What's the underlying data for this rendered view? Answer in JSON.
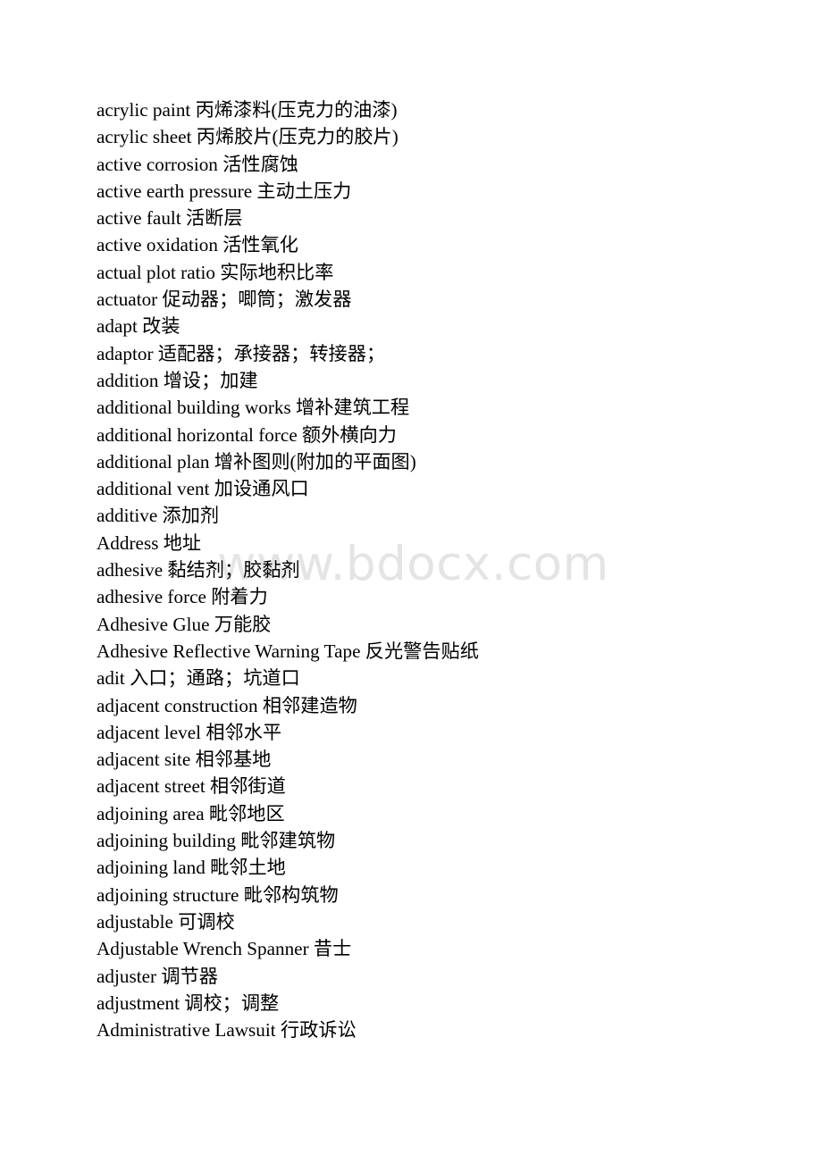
{
  "page": {
    "background_color": "#ffffff",
    "text_color": "#000000"
  },
  "watermark": {
    "text": "www.bdocx.com",
    "color": "#e4e4e4"
  },
  "glossary": {
    "entries": [
      "acrylic paint 丙烯漆料(压克力的油漆)",
      "acrylic sheet 丙烯胶片(压克力的胶片)",
      "active corrosion 活性腐蚀",
      "active earth pressure 主动土压力",
      "active fault 活断层",
      "active oxidation 活性氧化",
      "actual plot ratio 实际地积比率",
      "actuator 促动器；唧筒；激发器",
      "adapt 改装",
      "adaptor 适配器；承接器；转接器；",
      "addition 增设；加建",
      "additional building works 增补建筑工程",
      "additional horizontal force 额外横向力",
      "additional plan 增补图则(附加的平面图)",
      "additional vent 加设通风口",
      "additive 添加剂",
      "Address 地址",
      "adhesive 黏结剂；胶黏剂",
      "adhesive force 附着力",
      "Adhesive Glue 万能胶",
      "Adhesive Reflective Warning Tape 反光警告贴纸",
      "adit 入口；通路；坑道口",
      "adjacent construction 相邻建造物",
      "adjacent level 相邻水平",
      "adjacent site 相邻基地",
      "adjacent street 相邻街道",
      "adjoining area 毗邻地区",
      "adjoining building 毗邻建筑物",
      "adjoining land 毗邻土地",
      "adjoining structure 毗邻构筑物",
      "adjustable 可调校",
      "Adjustable Wrench Spanner 昔士",
      "adjuster 调节器",
      "adjustment 调校；调整",
      "Administrative Lawsuit 行政诉讼"
    ]
  }
}
